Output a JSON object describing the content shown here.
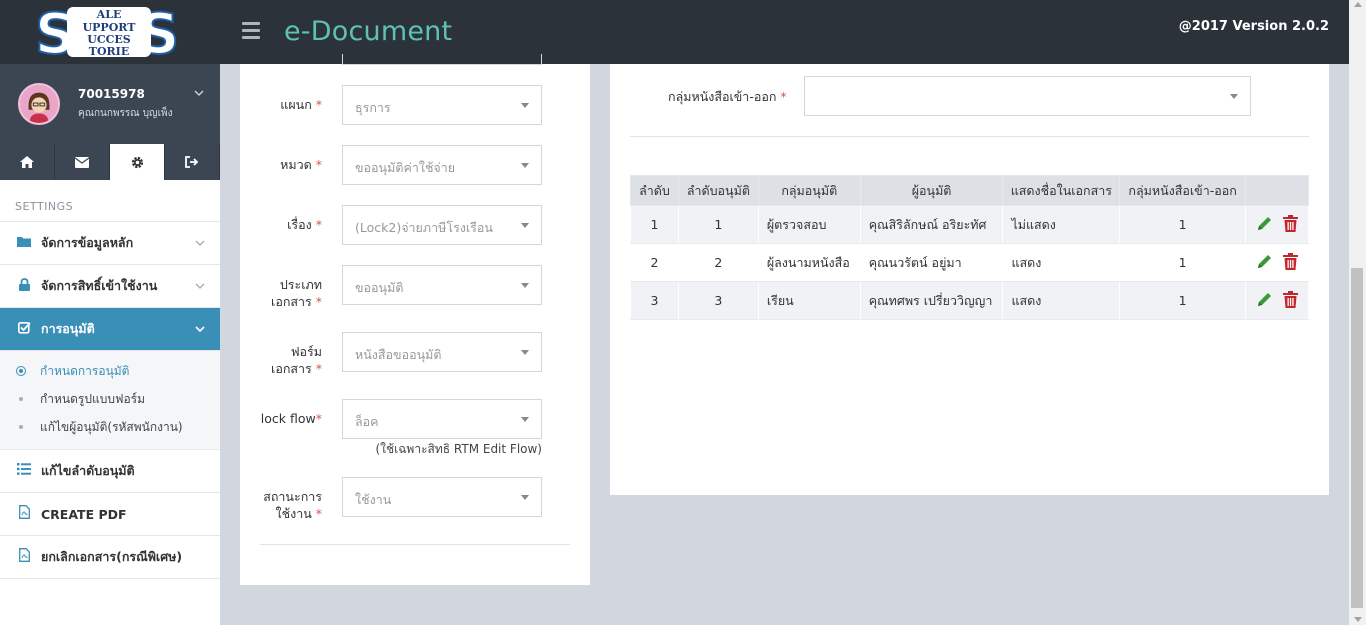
{
  "logo": {
    "line1": "ALE",
    "line2": "UPPORT",
    "line3": "UCCES",
    "line4": "TORIE",
    "big_letter": "S"
  },
  "user": {
    "id": "70015978",
    "name": "คุณกนกพรรณ บุญเพ็ง"
  },
  "quick_tabs": [
    {
      "icon": "home-icon"
    },
    {
      "icon": "envelope-icon"
    },
    {
      "icon": "gear-icon"
    },
    {
      "icon": "sign-out-icon"
    }
  ],
  "sidebar": {
    "header": "SETTINGS",
    "items": [
      {
        "label": "จัดการข้อมูลหลัก",
        "icon": "folder-icon"
      },
      {
        "label": "จัดการสิทธิ์เข้าใช้งาน",
        "icon": "lock-icon"
      },
      {
        "label": "การอนุมัติ",
        "icon": "check-square-icon"
      },
      {
        "label": "แก้ไขลำดับอนุมัติ",
        "icon": "list-icon"
      },
      {
        "label": "CREATE PDF",
        "icon": "pdf-icon"
      },
      {
        "label": "ยกเลิกเอกสาร(กรณีพิเศษ)",
        "icon": "pdf-icon"
      }
    ],
    "submenu": [
      {
        "label": "กำหนดการอนุมัติ"
      },
      {
        "label": "กำหนดรูปแบบฟอร์ม"
      },
      {
        "label": "แก้ไขผู้อนุมัติ(รหัสพนักงาน)"
      }
    ]
  },
  "header": {
    "title": "e-Document",
    "version": "@2017 Version 2.0.2"
  },
  "form": {
    "required_mark": "*",
    "department": {
      "label": "แผนก",
      "value": "ธุรการ"
    },
    "category": {
      "label": "หมวด",
      "value": "ขออนุมัติค่าใช้จ่าย"
    },
    "subject": {
      "label": "เรื่อง",
      "value": "(Lock2)จ่ายภาษีโรงเรือน"
    },
    "doc_type": {
      "label_l1": "ประเภท",
      "label_l2": "เอกสาร",
      "value": "ขออนุมัติ"
    },
    "doc_form": {
      "label_l1": "ฟอร์ม",
      "label_l2": "เอกสาร",
      "value": "หนังสือขออนุมัติ"
    },
    "lock_flow": {
      "label": "lock flow",
      "value": "ล็อค",
      "hint": "(ใช้เฉพาะสิทธิ RTM Edit Flow)"
    },
    "status": {
      "label_l1": "สถานะการ",
      "label_l2": "ใช้งาน",
      "value": "ใช้งาน"
    }
  },
  "group": {
    "label": "กลุ่มหนังสือเข้า-ออก",
    "value": ""
  },
  "table": {
    "headers": [
      "ลำดับ",
      "ลำดับอนุมัติ",
      "กลุ่มอนุมัติ",
      "ผู้อนุมัติ",
      "แสดงชื่อในเอกสาร",
      "กลุ่มหนังสือเข้า-ออก",
      ""
    ],
    "rows": [
      {
        "no": "1",
        "order": "1",
        "group": "ผู้ตรวจสอบ",
        "approver": "คุณสิริลักษณ์ อริยะทัศ",
        "show_name": "ไม่แสดง",
        "letter_group": "1"
      },
      {
        "no": "2",
        "order": "2",
        "group": "ผู้ลงนามหนังสือ",
        "approver": "คุณนวรัตน์ อยู่มา",
        "show_name": "แสดง",
        "letter_group": "1"
      },
      {
        "no": "3",
        "order": "3",
        "group": "เรียน",
        "approver": "คุณทศพร เปรี่ยววิญญา",
        "show_name": "แสดง",
        "letter_group": "1"
      }
    ]
  },
  "colors": {
    "accent": "#3a8fb7",
    "title": "#5fc1b4",
    "header_bg": "#2b323a",
    "edit": "#3a9a3a",
    "delete": "#c0272d"
  }
}
